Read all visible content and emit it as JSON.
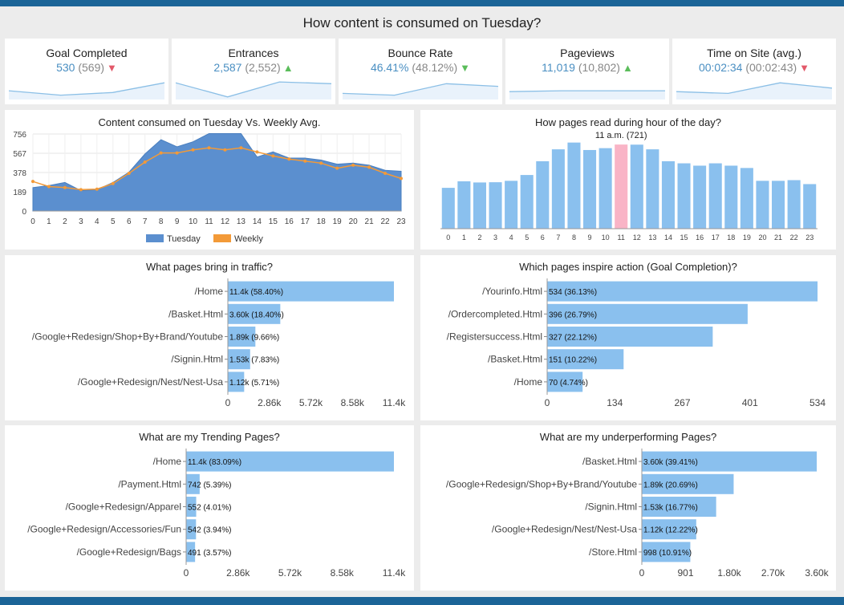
{
  "page_title": "How content is consumed on Tuesday?",
  "kpis": [
    {
      "label": "Goal Completed",
      "value": "530",
      "previous": "(569)",
      "trend": "down",
      "spark": [
        0.45,
        0.2,
        0.35,
        0.9
      ]
    },
    {
      "label": "Entrances",
      "value": "2,587",
      "previous": "(2,552)",
      "trend": "up",
      "spark": [
        0.9,
        0.1,
        0.95,
        0.85
      ]
    },
    {
      "label": "Bounce Rate",
      "value": "46.41%",
      "previous": "(48.12%)",
      "trend": "down",
      "spark": [
        0.3,
        0.2,
        0.85,
        0.7
      ]
    },
    {
      "label": "Pageviews",
      "value": "11,019",
      "previous": "(10,802)",
      "trend": "up",
      "spark": [
        0.4,
        0.45,
        0.45,
        0.45
      ]
    },
    {
      "label": "Time on Site (avg.)",
      "value": "00:02:34",
      "previous": "(00:02:43)",
      "trend": "down",
      "spark": [
        0.4,
        0.3,
        0.9,
        0.6
      ]
    }
  ],
  "chart_data": [
    {
      "type": "area",
      "title": "Content consumed on Tuesday Vs. Weekly Avg.",
      "x": [
        0,
        1,
        2,
        3,
        4,
        5,
        6,
        7,
        8,
        9,
        10,
        11,
        12,
        13,
        14,
        15,
        16,
        17,
        18,
        19,
        20,
        21,
        22,
        23
      ],
      "y_ticks": [
        0,
        189,
        378,
        567,
        756
      ],
      "ylim": [
        0,
        756
      ],
      "legend_position": "bottom",
      "series": [
        {
          "name": "Tuesday",
          "type": "area",
          "color": "#5b8fcf",
          "values": [
            230,
            250,
            280,
            200,
            210,
            280,
            380,
            560,
            700,
            630,
            680,
            760,
            760,
            760,
            530,
            580,
            520,
            520,
            500,
            460,
            470,
            450,
            400,
            390
          ]
        },
        {
          "name": "Weekly",
          "type": "line",
          "color": "#f39a38",
          "values": [
            290,
            240,
            230,
            210,
            215,
            270,
            370,
            480,
            570,
            570,
            600,
            620,
            600,
            620,
            580,
            540,
            510,
            490,
            470,
            420,
            450,
            430,
            370,
            320
          ]
        }
      ]
    },
    {
      "type": "bar",
      "title": "How pages read during hour of the day?",
      "annotation": "11 a.m. (721)",
      "categories": [
        "0",
        "1",
        "2",
        "3",
        "4",
        "5",
        "6",
        "7",
        "8",
        "9",
        "10",
        "11",
        "12",
        "13",
        "14",
        "15",
        "16",
        "17",
        "18",
        "19",
        "20",
        "21",
        "22",
        "23"
      ],
      "values": [
        350,
        406,
        396,
        398,
        410,
        460,
        578,
        680,
        738,
        674,
        690,
        721,
        720,
        680,
        578,
        560,
        540,
        560,
        540,
        520,
        410,
        410,
        416,
        382
      ],
      "highlight_index": 11,
      "ylim": [
        0,
        880
      ],
      "bar_color": "#8ac0ee",
      "highlight_color": "#f9b4c6"
    },
    {
      "type": "bar",
      "orientation": "horizontal",
      "title": "What pages bring in traffic?",
      "categories": [
        "/Home",
        "/Basket.Html",
        "/Google+Redesign/Shop+By+Brand/Youtube",
        "/Signin.Html",
        "/Google+Redesign/Nest/Nest-Usa"
      ],
      "values": [
        11400,
        3600,
        1890,
        1530,
        1120
      ],
      "labels": [
        "11.4k (58.40%)",
        "3.60k (18.40%)",
        "1.89k (9.66%)",
        "1.53k (7.83%)",
        "1.12k (5.71%)"
      ],
      "x_ticks": [
        "0",
        "2.86k",
        "5.72k",
        "8.58k",
        "11.4k"
      ],
      "xlim": [
        0,
        11400
      ]
    },
    {
      "type": "bar",
      "orientation": "horizontal",
      "title": "Which pages inspire action (Goal Completion)?",
      "categories": [
        "/Yourinfo.Html",
        "/Ordercompleted.Html",
        "/Registersuccess.Html",
        "/Basket.Html",
        "/Home"
      ],
      "values": [
        534,
        396,
        327,
        151,
        70
      ],
      "labels": [
        "534 (36.13%)",
        "396 (26.79%)",
        "327 (22.12%)",
        "151 (10.22%)",
        "70 (4.74%)"
      ],
      "x_ticks": [
        "0",
        "134",
        "267",
        "401",
        "534"
      ],
      "xlim": [
        0,
        534
      ]
    },
    {
      "type": "bar",
      "orientation": "horizontal",
      "title": "What are my Trending Pages?",
      "categories": [
        "/Home",
        "/Payment.Html",
        "/Google+Redesign/Apparel",
        "/Google+Redesign/Accessories/Fun",
        "/Google+Redesign/Bags"
      ],
      "values": [
        11400,
        742,
        552,
        542,
        491
      ],
      "labels": [
        "11.4k (83.09%)",
        "742 (5.39%)",
        "552 (4.01%)",
        "542 (3.94%)",
        "491 (3.57%)"
      ],
      "x_ticks": [
        "0",
        "2.86k",
        "5.72k",
        "8.58k",
        "11.4k"
      ],
      "xlim": [
        0,
        11400
      ]
    },
    {
      "type": "bar",
      "orientation": "horizontal",
      "title": "What are my underperforming Pages?",
      "categories": [
        "/Basket.Html",
        "/Google+Redesign/Shop+By+Brand/Youtube",
        "/Signin.Html",
        "/Google+Redesign/Nest/Nest-Usa",
        "/Store.Html"
      ],
      "values": [
        3600,
        1890,
        1530,
        1120,
        998
      ],
      "labels": [
        "3.60k (39.41%)",
        "1.89k (20.69%)",
        "1.53k (16.77%)",
        "1.12k (12.22%)",
        "998 (10.91%)"
      ],
      "x_ticks": [
        "0",
        "901",
        "1.80k",
        "2.70k",
        "3.60k"
      ],
      "xlim": [
        0,
        3600
      ]
    }
  ],
  "colors": {
    "header": "#1b6497",
    "bar": "#8ac0ee",
    "kpi_value": "#4a8fc2",
    "down_arrow": "#e3596a",
    "up_arrow": "#5bbd5b"
  }
}
